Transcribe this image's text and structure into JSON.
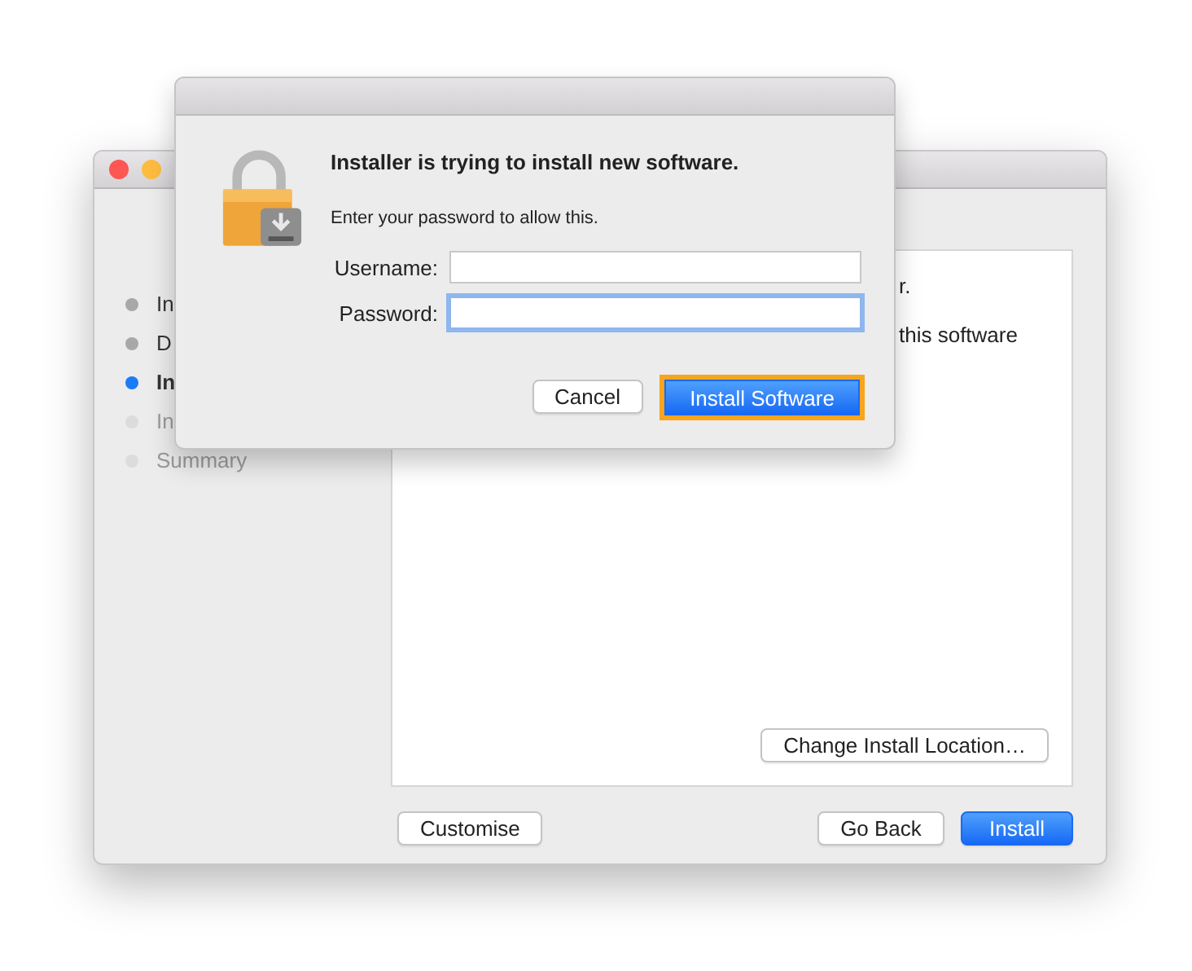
{
  "window": {
    "traffic_lights": [
      {
        "color": "#fc5753"
      },
      {
        "color": "#fdbc40"
      }
    ]
  },
  "sidebar": {
    "items": [
      {
        "label": "In",
        "selected": false,
        "disabled": false
      },
      {
        "label": "D",
        "selected": false,
        "disabled": false
      },
      {
        "label": "In",
        "selected": true,
        "disabled": false
      },
      {
        "label": "In",
        "selected": false,
        "disabled": true
      },
      {
        "label": "Summary",
        "selected": false,
        "disabled": true
      }
    ]
  },
  "content": {
    "lines": [
      "r.",
      "this software"
    ]
  },
  "change_location_button": "Change Install Location…",
  "footer": {
    "left_button": "Customise",
    "buttons": [
      {
        "label": "Go Back",
        "default": false
      },
      {
        "label": "Install",
        "default": true
      }
    ]
  },
  "dialog": {
    "title": "Installer is trying to install new software.",
    "message": "Enter your password to allow this.",
    "fields": [
      {
        "label": "Username:",
        "focused": false
      },
      {
        "label": "Password:",
        "focused": true
      }
    ],
    "buttons": [
      {
        "label": "Cancel",
        "default": false,
        "highlighted": false
      },
      {
        "label": "Install Software",
        "default": true,
        "highlighted": true
      }
    ]
  }
}
